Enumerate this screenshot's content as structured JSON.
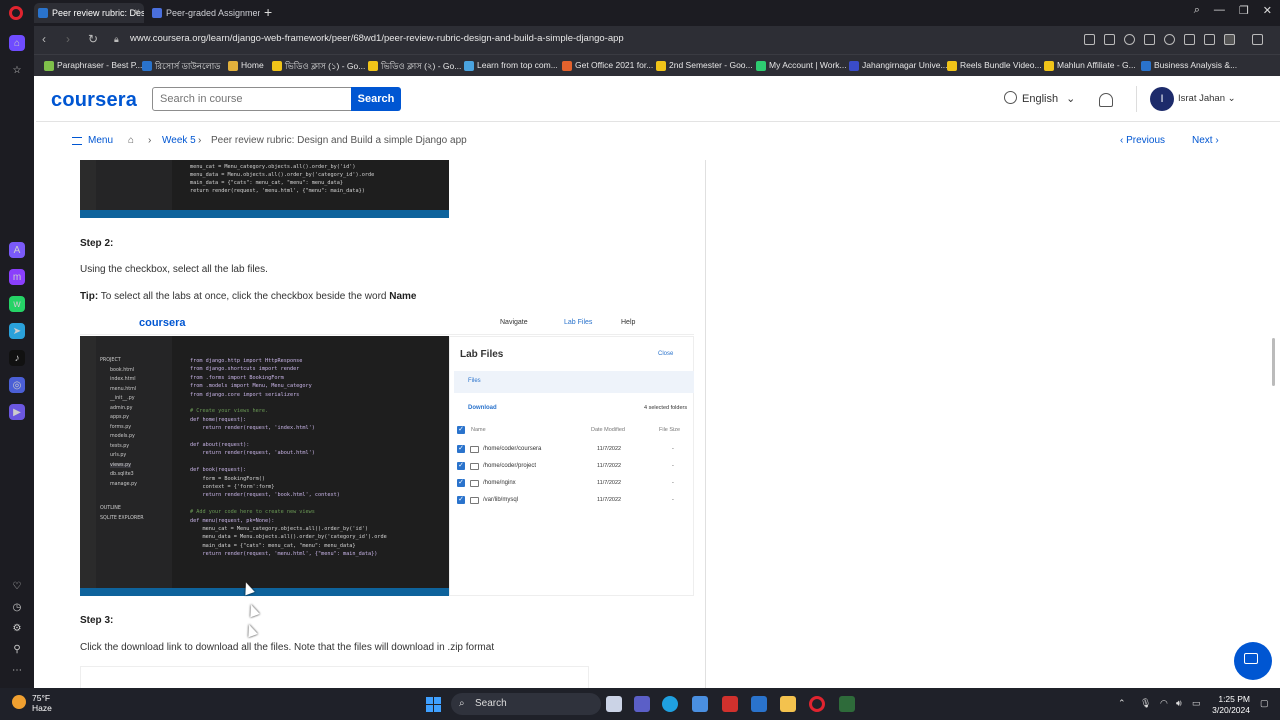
{
  "browser": {
    "tabs": [
      {
        "title": "Peer review rubric: Design",
        "active": true
      },
      {
        "title": "Peer-graded Assignment:",
        "active": false
      }
    ],
    "url": "www.coursera.org/learn/django-web-framework/peer/68wd1/peer-review-rubric-design-and-build-a-simple-django-app",
    "bookmarks": [
      "Paraphraser - Best P...",
      "রিসোর্স ডাউনলোড",
      "Home",
      "ভিডিও ক্লাস (১) - Go...",
      "ভিডিও ক্লাস (২) - Go...",
      "Learn from top com...",
      "Get Office 2021 for...",
      "2nd Semester - Goo...",
      "My Account | Work...",
      "Jahangirnagar Unive...",
      "Reels Bundle Video...",
      "Mahlun Affiliate - G...",
      "Business Analysis &..."
    ]
  },
  "coursera": {
    "logo": "coursera",
    "search_placeholder": "Search in course",
    "search_button": "Search",
    "language": "English",
    "user_initial": "I",
    "user_name": "Israt Jahan",
    "menu_label": "Menu",
    "breadcrumb": {
      "week": "Week 5",
      "page": "Peer review rubric: Design and Build a simple Django app"
    },
    "prev_label": "Previous",
    "next_label": "Next"
  },
  "content": {
    "step2_title": "Step 2:",
    "step2_text": "Using the checkbox, select all the lab files.",
    "tip_label": "Tip:",
    "tip_text": " To select all the labs at once, click the checkbox beside the word ",
    "tip_bold": "Name",
    "step3_title": "Step 3:",
    "step3_text": "Click the download link to download all the files. Note that the files will download in .zip format"
  },
  "lab_screenshot": {
    "brand": "coursera",
    "nav": [
      "Navigate",
      "Lab Files",
      "Help"
    ],
    "panel_title": "Lab Files",
    "close": "Close",
    "files_tab": "Files",
    "download": "Download",
    "selected": "4 selected folders",
    "columns": [
      "Name",
      "Date Modified",
      "File Size"
    ],
    "rows": [
      {
        "name": "/home/coder/coursera",
        "date": "11/7/2022",
        "size": "-"
      },
      {
        "name": "/home/coder/project",
        "date": "11/7/2022",
        "size": "-"
      },
      {
        "name": "/home/nginx",
        "date": "11/7/2022",
        "size": "-"
      },
      {
        "name": "/var/lib/mysql",
        "date": "11/7/2022",
        "size": "-"
      }
    ]
  },
  "code_snippet": {
    "top": [
      "menu_cat = Menu_category.objects.all().order_by('id')",
      "menu_data = Menu.objects.all().order_by('category_id').orde",
      "main_data = {\"cats\": menu_cat, \"menu\": menu_data}",
      "return render(request, 'menu.html', {\"menu\": main_data})"
    ],
    "main": [
      "from django.http import HttpResponse",
      "from django.shortcuts import render",
      "from .forms import BookingForm",
      "from .models import Menu, Menu_category",
      "from django.core import serializers",
      "",
      "# Create your views here.",
      "def home(request):",
      "    return render(request, 'index.html')",
      "",
      "def about(request):",
      "    return render(request, 'about.html')",
      "",
      "def book(request):",
      "    form = BookingForm()",
      "    context = {'form':form}",
      "    return render(request, 'book.html', context)",
      "",
      "# Add your code here to create new views",
      "def menu(request, pk=None):",
      "    menu_cat = Menu_category.objects.all().order_by('id')",
      "    menu_data = Menu.objects.all().order_by('category_id').orde",
      "    main_data = {\"cats\": menu_cat, \"menu\": menu_data}",
      "    return render(request, 'menu.html', {\"menu\": main_data})"
    ],
    "tree": [
      "PROJECT",
      "book.html",
      "index.html",
      "menu.html",
      "__init__.py",
      "admin.py",
      "apps.py",
      "forms.py",
      "models.py",
      "tests.py",
      "urls.py",
      "views.py",
      "db.sqlite3",
      "manage.py",
      "OUTLINE",
      "SQLITE EXPLORER"
    ]
  },
  "taskbar": {
    "temp": "75°F",
    "weather": "Haze",
    "search": "Search",
    "time": "1:25 PM",
    "date": "3/20/2024"
  }
}
